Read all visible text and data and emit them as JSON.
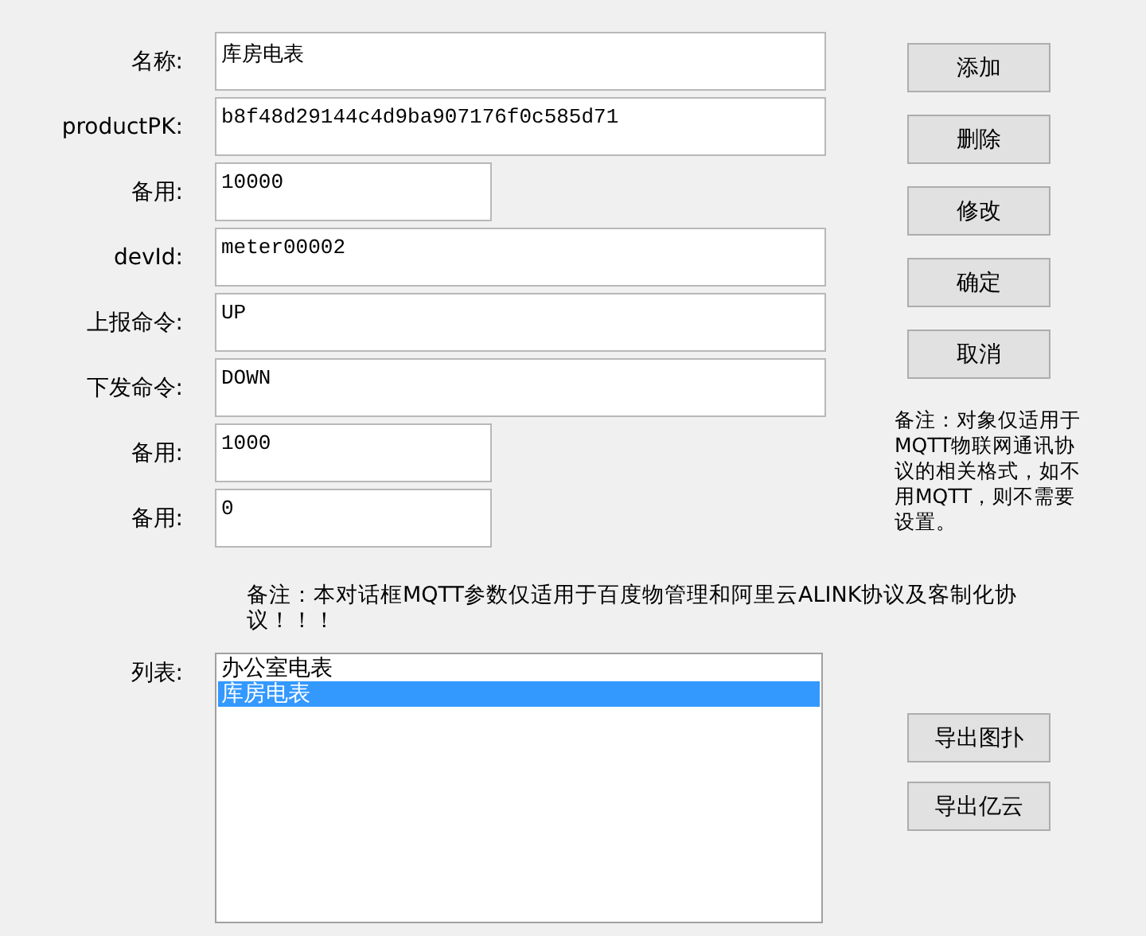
{
  "fields": [
    {
      "label": "名称:",
      "value": "库房电表",
      "kind": "wide"
    },
    {
      "label": "productPK:",
      "value": "b8f48d29144c4d9ba907176f0c585d71",
      "kind": "wide"
    },
    {
      "label": "备用:",
      "value": "10000",
      "kind": "short"
    },
    {
      "label": "devId:",
      "value": "meter00002",
      "kind": "wide"
    },
    {
      "label": "上报命令:",
      "value": "UP",
      "kind": "wide"
    },
    {
      "label": "下发命令:",
      "value": "DOWN",
      "kind": "wide"
    },
    {
      "label": "备用:",
      "value": "1000",
      "kind": "short"
    },
    {
      "label": "备用:",
      "value": "0",
      "kind": "short"
    }
  ],
  "buttons": [
    "添加",
    "删除",
    "修改",
    "确定",
    "取消"
  ],
  "side_note": "备注：对象仅适用于MQTT物联网通讯协议的相关格式，如不用MQTT，则不需要设置。",
  "note": "备注：本对话框MQTT参数仅适用于百度物管理和阿里云ALINK协议及客制化协议！！！",
  "list": {
    "label": "列表:",
    "items": [
      {
        "text": "办公室电表",
        "selected": false
      },
      {
        "text": "库房电表",
        "selected": true
      }
    ]
  },
  "export_buttons": [
    "导出图扑",
    "导出亿云"
  ]
}
